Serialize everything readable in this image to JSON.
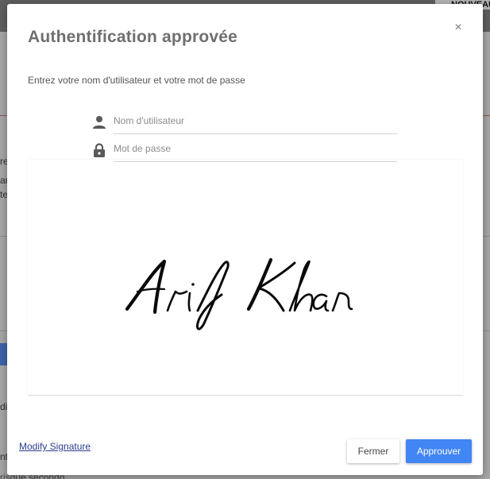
{
  "background": {
    "top_button": "NOUVEAU",
    "fragments": [
      "re",
      "ar",
      "te",
      "di",
      "nt"
    ],
    "bottom_text": "risque secondo"
  },
  "dialog": {
    "title": "Authentification approvée",
    "close_symbol": "×",
    "instructions": "Entrez votre nom d'utilisateur et votre mot de passe",
    "username": {
      "value": "",
      "placeholder": "Nom d'utilisateur",
      "icon": "person-icon"
    },
    "password": {
      "value": "",
      "placeholder": "Mot de passe",
      "icon": "lock-icon"
    },
    "signature": {
      "text": "Arif Khan"
    },
    "modify_link": "Modify Signature",
    "buttons": {
      "close": "Fermer",
      "approve": "Approuver"
    }
  },
  "colors": {
    "primary": "#4285f4",
    "link": "#2b3d8c",
    "title": "#6f6f6f"
  }
}
